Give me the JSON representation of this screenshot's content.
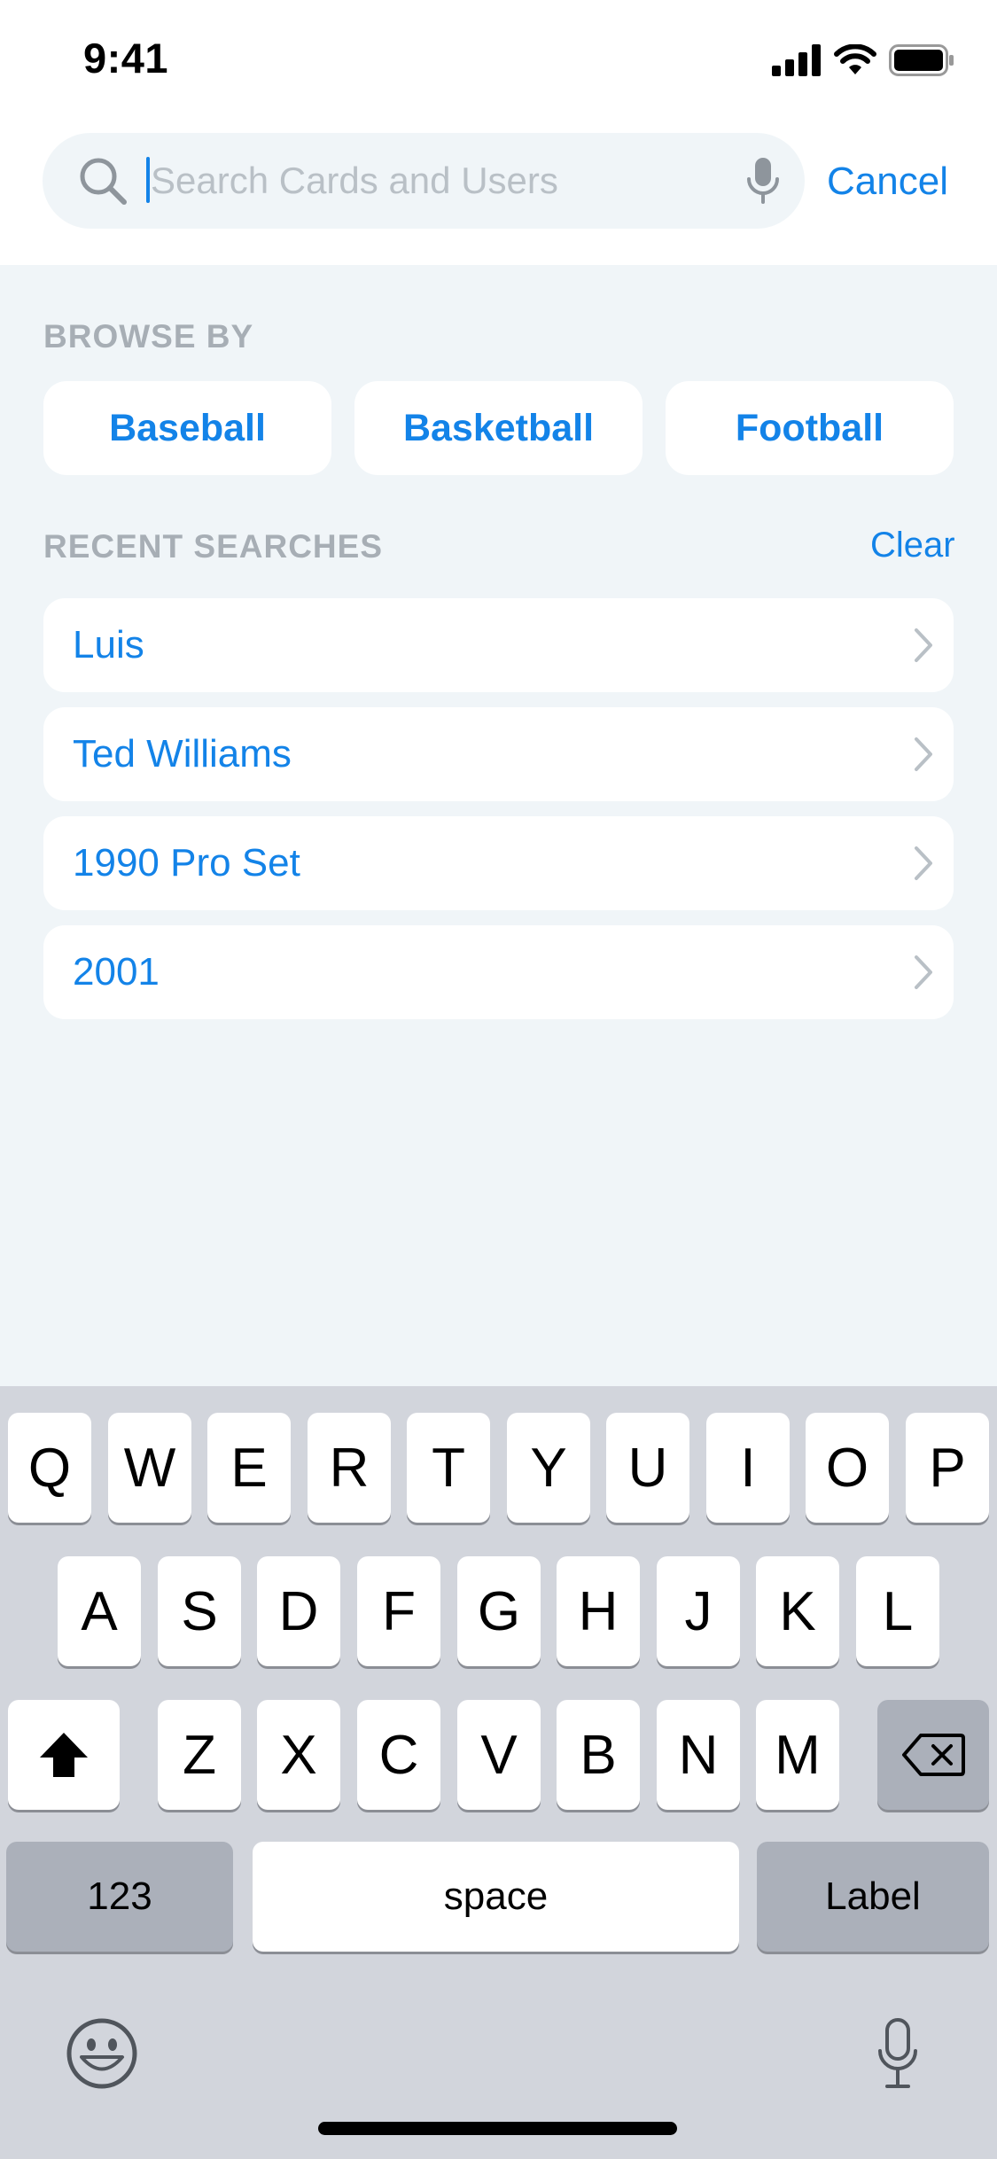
{
  "status_bar": {
    "time": "9:41",
    "icons": [
      "cellular-signal-icon",
      "wifi-icon",
      "battery-icon"
    ]
  },
  "search": {
    "placeholder": "Search Cards and Users",
    "value": "",
    "cancel_label": "Cancel"
  },
  "browse": {
    "label": "BROWSE BY",
    "chips": [
      "Baseball",
      "Basketball",
      "Football"
    ]
  },
  "recent": {
    "label": "RECENT SEARCHES",
    "clear_label": "Clear",
    "items": [
      "Luis",
      "Ted Williams",
      "1990 Pro Set",
      "2001"
    ]
  },
  "keyboard": {
    "row1": [
      "Q",
      "W",
      "E",
      "R",
      "T",
      "Y",
      "U",
      "I",
      "O",
      "P"
    ],
    "row2": [
      "A",
      "S",
      "D",
      "F",
      "G",
      "H",
      "J",
      "K",
      "L"
    ],
    "row3": [
      "Z",
      "X",
      "C",
      "V",
      "B",
      "N",
      "M"
    ],
    "numbers_label": "123",
    "space_label": "space",
    "return_label": "Label"
  },
  "colors": {
    "accent": "#1383e8",
    "background": "#f0f5f8",
    "section_label": "#a7aeb5",
    "keyboard_bg": "#d2d5dc"
  }
}
